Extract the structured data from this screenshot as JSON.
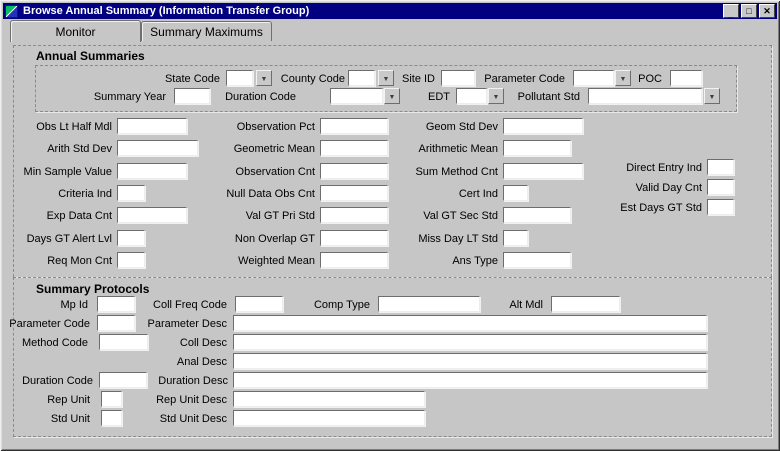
{
  "window": {
    "title": "Browse Annual Summary (Information Transfer Group)",
    "controls": [
      {
        "name": "minimize",
        "glyph": "_"
      },
      {
        "name": "maximize",
        "glyph": "□"
      },
      {
        "name": "close",
        "glyph": "✕"
      }
    ]
  },
  "icons": {
    "dropdown": "▼"
  },
  "tabs": [
    {
      "label": "Monitor",
      "active": true
    },
    {
      "label": "Summary Maximums",
      "active": false
    }
  ],
  "annual_summaries": {
    "heading": "Annual Summaries",
    "keys": {
      "state_code": "State Code",
      "county_code": "County Code",
      "site_id": "Site ID",
      "parameter_code": "Parameter Code",
      "poc": "POC",
      "summary_year": "Summary Year",
      "duration_code": "Duration Code",
      "edt": "EDT",
      "pollutant_std": "Pollutant Std"
    },
    "grid": {
      "col1": [
        "Obs Lt Half Mdl",
        "Arith Std Dev",
        "Min Sample Value",
        "Criteria Ind",
        "Exp Data Cnt",
        "Days GT Alert Lvl",
        "Req Mon Cnt"
      ],
      "col2": [
        "Observation Pct",
        "Geometric Mean",
        "Observation Cnt",
        "Null Data Obs Cnt",
        "Val GT Pri Std",
        "Non Overlap GT",
        "Weighted Mean"
      ],
      "col3": [
        "Geom Std Dev",
        "Arithmetic Mean",
        "Sum Method Cnt",
        "Cert Ind",
        "Val GT Sec Std",
        "Miss Day LT Std",
        "Ans Type"
      ],
      "col4": [
        "Direct Entry Ind",
        "Valid Day Cnt",
        "Est Days GT Std"
      ]
    },
    "field_value": ""
  },
  "summary_protocols": {
    "heading": "Summary Protocols",
    "labels": {
      "mp_id": "Mp Id",
      "coll_freq_code": "Coll Freq Code",
      "comp_type": "Comp Type",
      "alt_mdl": "Alt Mdl",
      "parameter_code": "Parameter Code",
      "parameter_desc": "Parameter Desc",
      "method_code": "Method Code",
      "coll_desc": "Coll Desc",
      "anal_desc": "Anal Desc",
      "duration_code": "Duration Code",
      "duration_desc": "Duration Desc",
      "rep_unit": "Rep Unit",
      "rep_unit_desc": "Rep Unit Desc",
      "std_unit": "Std Unit",
      "std_unit_desc": "Std Unit Desc"
    },
    "field_value": ""
  },
  "colors": {
    "titlebar": "#000080",
    "window_bg": "#c6c6c6",
    "field_bg": "#ffffff",
    "text": "#000000"
  }
}
